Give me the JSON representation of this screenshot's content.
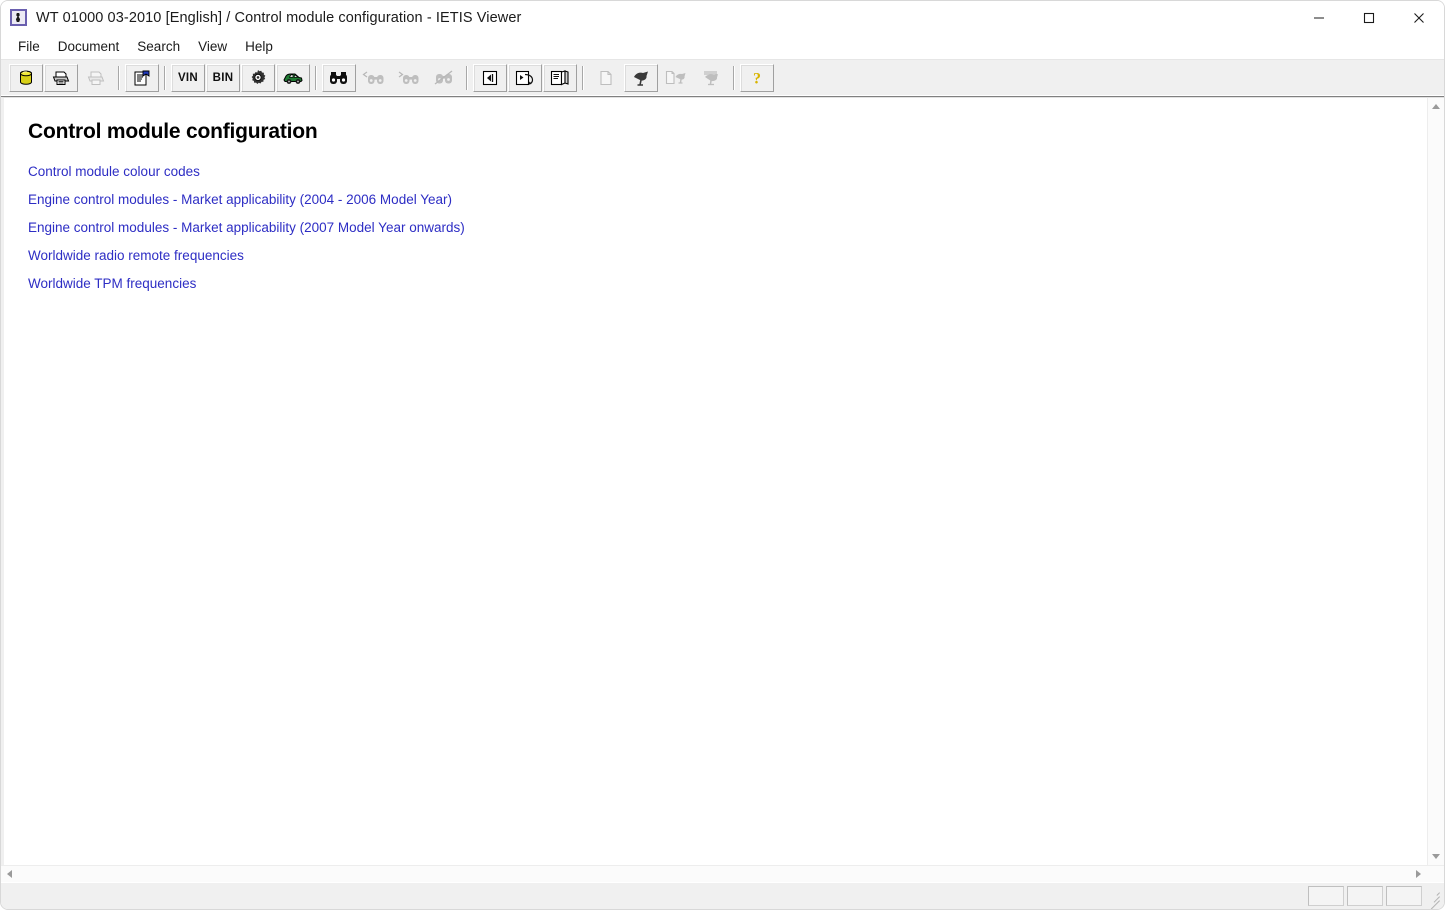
{
  "window": {
    "title": "WT 01000 03-2010 [English] / Control module configuration - IETIS Viewer",
    "app_icon": "app-icon",
    "controls": {
      "minimize": "minimize",
      "maximize": "maximize",
      "close": "close"
    }
  },
  "menubar": {
    "items": [
      {
        "label": "File"
      },
      {
        "label": "Document"
      },
      {
        "label": "Search"
      },
      {
        "label": "View"
      },
      {
        "label": "Help"
      }
    ]
  },
  "toolbar": {
    "groups": [
      {
        "buttons": [
          {
            "name": "database-icon",
            "label": "",
            "type": "icon",
            "enabled": true
          },
          {
            "name": "print-icon",
            "label": "",
            "type": "icon",
            "enabled": true
          },
          {
            "name": "print-preview-icon",
            "label": "",
            "type": "icon",
            "enabled": false
          }
        ]
      },
      {
        "buttons": [
          {
            "name": "document-properties-icon",
            "label": "",
            "type": "icon",
            "enabled": true
          }
        ]
      },
      {
        "buttons": [
          {
            "name": "vin-button",
            "label": "VIN",
            "type": "text",
            "enabled": true
          },
          {
            "name": "bin-button",
            "label": "BIN",
            "type": "text",
            "enabled": true
          },
          {
            "name": "gear-icon",
            "label": "",
            "type": "icon",
            "enabled": true
          },
          {
            "name": "vehicle-icon",
            "label": "",
            "type": "icon",
            "enabled": true
          }
        ]
      },
      {
        "buttons": [
          {
            "name": "search-icon",
            "label": "",
            "type": "icon",
            "enabled": true
          },
          {
            "name": "search-previous-icon",
            "label": "",
            "type": "icon",
            "enabled": false
          },
          {
            "name": "search-next-icon",
            "label": "",
            "type": "icon",
            "enabled": false
          },
          {
            "name": "clear-search-icon",
            "label": "",
            "type": "icon",
            "enabled": false
          }
        ]
      },
      {
        "buttons": [
          {
            "name": "go-back-icon",
            "label": "",
            "type": "icon",
            "enabled": true
          },
          {
            "name": "history-icon",
            "label": "",
            "type": "icon",
            "enabled": true
          },
          {
            "name": "book-icon",
            "label": "",
            "type": "icon",
            "enabled": true
          }
        ]
      },
      {
        "buttons": [
          {
            "name": "new-page-icon",
            "label": "",
            "type": "icon",
            "enabled": false
          },
          {
            "name": "bookmark-icon",
            "label": "",
            "type": "icon",
            "enabled": true
          },
          {
            "name": "add-bookmark-icon",
            "label": "",
            "type": "icon",
            "enabled": false
          },
          {
            "name": "save-bookmark-icon",
            "label": "",
            "type": "icon",
            "enabled": false
          }
        ]
      },
      {
        "buttons": [
          {
            "name": "help-icon",
            "label": "",
            "type": "icon",
            "enabled": true
          }
        ]
      }
    ]
  },
  "document": {
    "title": "Control module configuration",
    "links": [
      {
        "label": "Control module colour codes"
      },
      {
        "label": "Engine control modules - Market applicability (2004 - 2006 Model Year)"
      },
      {
        "label": "Engine control modules - Market applicability (2007 Model Year onwards)"
      },
      {
        "label": "Worldwide radio remote frequencies"
      },
      {
        "label": "Worldwide TPM frequencies"
      }
    ]
  },
  "scrollbars": {
    "vertical": {
      "up": "scroll-up",
      "down": "scroll-down"
    },
    "horizontal": {
      "left": "scroll-left",
      "right": "scroll-right"
    }
  },
  "statusbar": {
    "message": "",
    "panels": [
      {
        "text": ""
      },
      {
        "text": ""
      },
      {
        "text": ""
      }
    ]
  },
  "colors": {
    "link": "#2d2dc4",
    "toolbar_bg": "#f0f0f0",
    "content_bg": "#ffffff",
    "help_icon": "#d8b400"
  }
}
